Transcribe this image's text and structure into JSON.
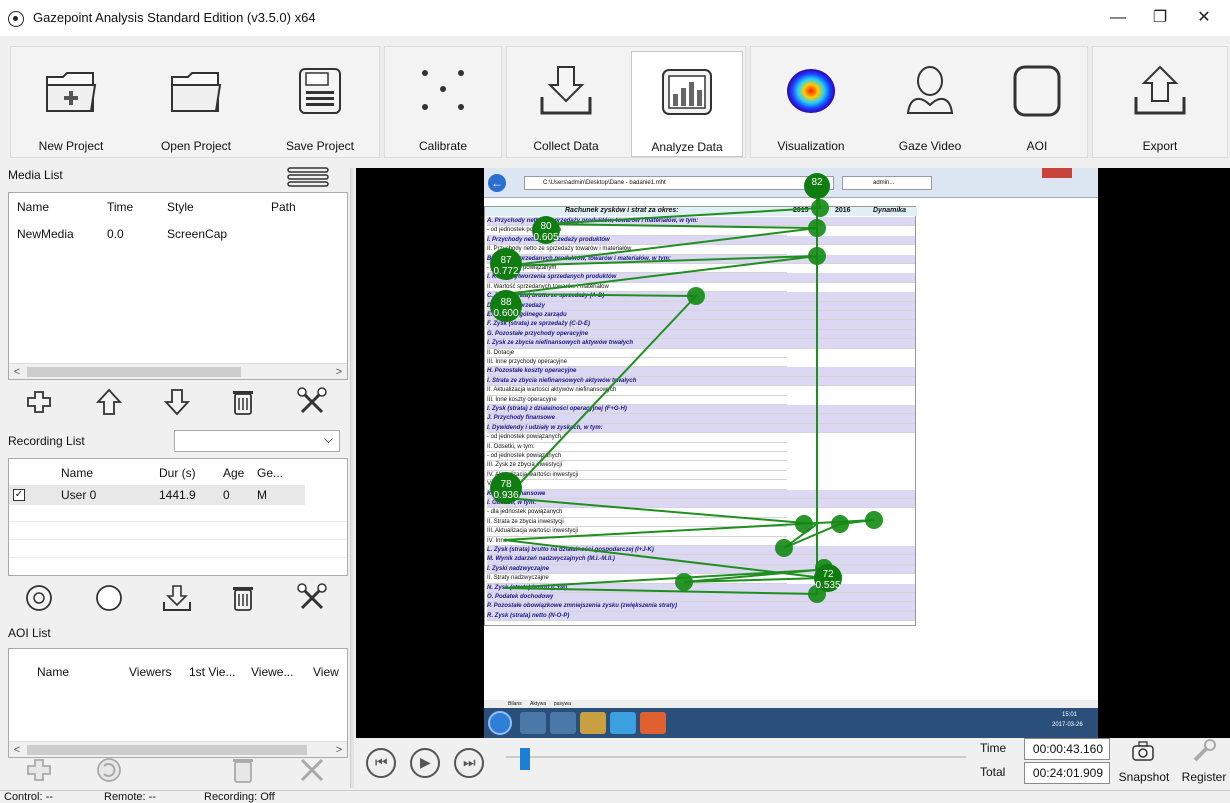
{
  "window": {
    "title": "Gazepoint Analysis Standard Edition (v3.5.0) x64",
    "minimize": "—",
    "maximize": "❐",
    "close": "✕"
  },
  "toolbar": {
    "new_project": "New Project",
    "open_project": "Open Project",
    "save_project": "Save Project",
    "calibrate": "Calibrate",
    "collect_data": "Collect Data",
    "analyze_data": "Analyze Data",
    "visualization": "Visualization",
    "gaze_video": "Gaze Video",
    "aoi": "AOI",
    "export": "Export"
  },
  "media_list": {
    "title": "Media List",
    "columns": [
      "Name",
      "Time",
      "Style",
      "Path"
    ],
    "rows": [
      {
        "name": "NewMedia",
        "time": "0.0",
        "style": "ScreenCap",
        "path": ""
      }
    ]
  },
  "recording_list": {
    "title": "Recording List",
    "dropdown_value": "",
    "columns": [
      "Name",
      "Dur (s)",
      "Age",
      "Ge..."
    ],
    "rows": [
      {
        "checked": true,
        "name": "User 0",
        "dur": "1441.9",
        "age": "0",
        "gender": "M"
      }
    ]
  },
  "aoi_list": {
    "title": "AOI List",
    "columns": [
      "Name",
      "Viewers",
      "1st Vie...",
      "Viewe...",
      "View"
    ]
  },
  "playback": {
    "time_label": "Time",
    "time_value": "00:00:43.160",
    "total_label": "Total",
    "total_value": "00:24:01.909",
    "progress": 0.03,
    "snapshot": "Snapshot",
    "register": "Register"
  },
  "status": {
    "control": "Control: --",
    "remote": "Remote: --",
    "recording": "Recording: Off"
  },
  "screen": {
    "address": "C:\\Users\\admin\\Desktop\\Dane - badanie1.mht",
    "tab": "admin...",
    "sheet_title": "Rachunek zysków i strat za okres:",
    "col_2015": "2015",
    "col_2016": "2016",
    "col_dyn": "Dynamika",
    "rows": [
      "A. Przychody netto ze sprzedaży produktów, towarów i materiałów, w tym:",
      "- od jednostek powiązanych",
      "I. Przychody netto ze sprzedaży produktów",
      "II. Przychody netto ze sprzedaży towarów i materiałów",
      "B. Koszty sprzedanych produktów, towarów i materiałów, w tym:",
      "- jednostkom powiązanym",
      "I. Koszt wytworzenia sprzedanych produktów",
      "II. Wartość sprzedanych towarów i materiałów",
      "C. Zysk (strata) brutto ze sprzedaży (A-B)",
      "D. Koszty sprzedaży",
      "E. Koszty ogólnego zarządu",
      "F. Zysk (strata) ze sprzedaży (C-D-E)",
      "G. Pozostałe przychody operacyjne",
      "I. Zysk ze zbycia niefinansowych aktywów trwałych",
      "II. Dotacje",
      "III. Inne przychody operacyjne",
      "H. Pozostałe koszty operacyjne",
      "I. Strata ze zbycia niefinansowych aktywów trwałych",
      "II. Aktualizacja wartości aktywów niefinansowych",
      "III. Inne koszty operacyjne",
      "I. Zysk (strata) z działalności operacyjnej (F+G-H)",
      "J. Przychody finansowe",
      "I. Dywidendy i udziały w zyskach, w tym:",
      "- od jednostek powiązanych",
      "II. Odsetki, w tym:",
      "- od jednostek powiązanych",
      "III. Zysk ze zbycia inwestycji",
      "IV. Aktualizacja wartości inwestycji",
      "V. Inne",
      "K. Koszty finansowe",
      "I. Odsetki, w tym:",
      "- dla jednostek powiązanych",
      "II. Strata ze zbycia inwestycji",
      "III. Aktualizacja wartości inwestycji",
      "IV. Inne",
      "L. Zysk (strata) brutto na działalności gospodarczej (I+J-K)",
      "M. Wynik zdarzeń nadzwyczajnych (M.I.-M.II.)",
      "I. Zyski nadzwyczajne",
      "II. Straty nadzwyczajne",
      "N. Zysk (strata) brutto (L+M)",
      "O. Podatek dochodowy",
      "P. Pozostałe obowiązkowe zmniejszenia zysku (zwiększenia straty)",
      "R. Zysk (strata) netto (N-O-P)"
    ],
    "sheet_tabs": [
      "Bilans",
      "Aktywa",
      "pasywa"
    ],
    "clock": "15:01",
    "date": "2017-03-26"
  },
  "fixations": [
    {
      "n": "80",
      "d": "0.605"
    },
    {
      "n": "87",
      "d": "0.772"
    },
    {
      "n": "88",
      "d": "0.600"
    },
    {
      "n": "78",
      "d": "0.936"
    },
    {
      "n": "82",
      "d": ""
    },
    {
      "n": "72",
      "d": "0.535"
    }
  ]
}
